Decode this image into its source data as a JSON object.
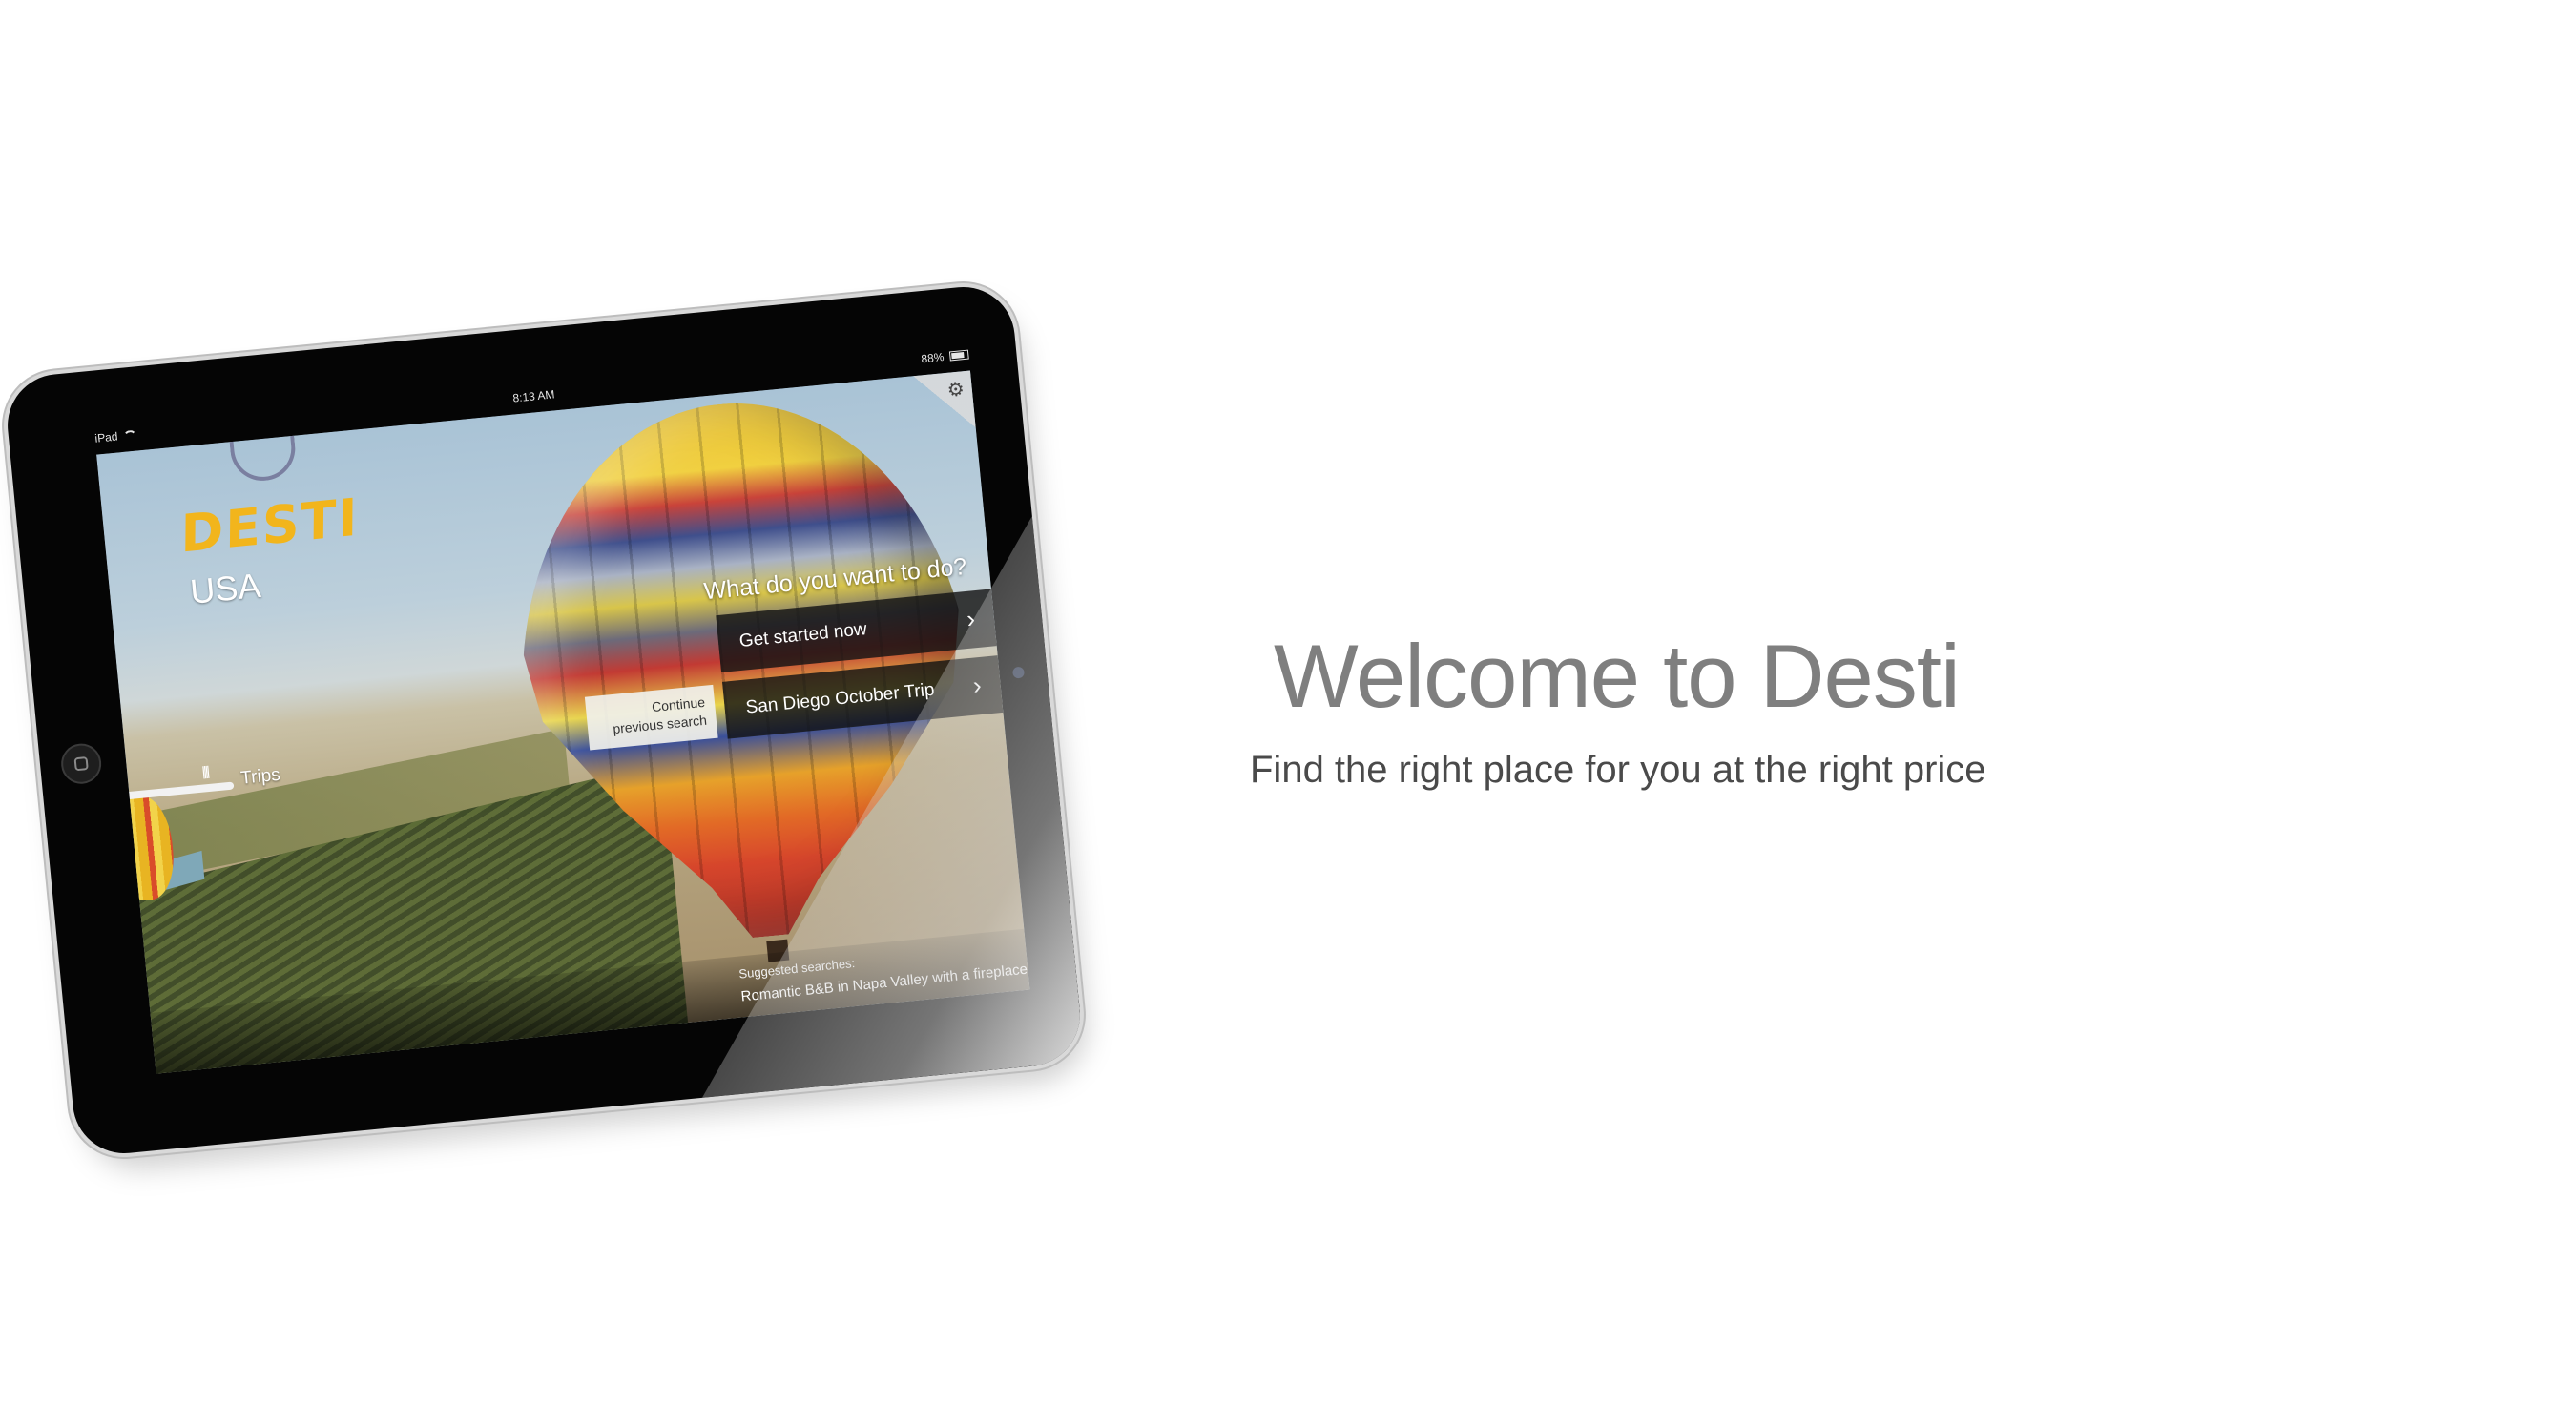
{
  "device": {
    "status_bar": {
      "carrier": "iPad",
      "time": "8:13 AM",
      "battery": "88%"
    }
  },
  "app": {
    "logo": "DESTI",
    "country": "USA",
    "question": "What do you want to do?",
    "get_started_label": "Get started now",
    "continue_label_line1": "Continue",
    "continue_label_line2": "previous search",
    "previous_search_label": "San Diego October Trip",
    "trips_label": "Trips",
    "suggested_heading": "Suggested searches:",
    "suggested_item": "Romantic B&B in Napa Valley with a fireplace",
    "icons": {
      "settings": "gear-icon",
      "chevron": "chevron-right-icon",
      "wifi": "wifi-icon",
      "battery": "battery-icon",
      "trips_grip": "grip-icon"
    }
  },
  "welcome": {
    "title": "Welcome to Desti",
    "subtitle": "Find the right place for you at the right price"
  },
  "colors": {
    "brand_yellow": "#f2b51c",
    "title_gray": "#7f7f7f",
    "subtitle_gray": "#4a4a4a"
  }
}
